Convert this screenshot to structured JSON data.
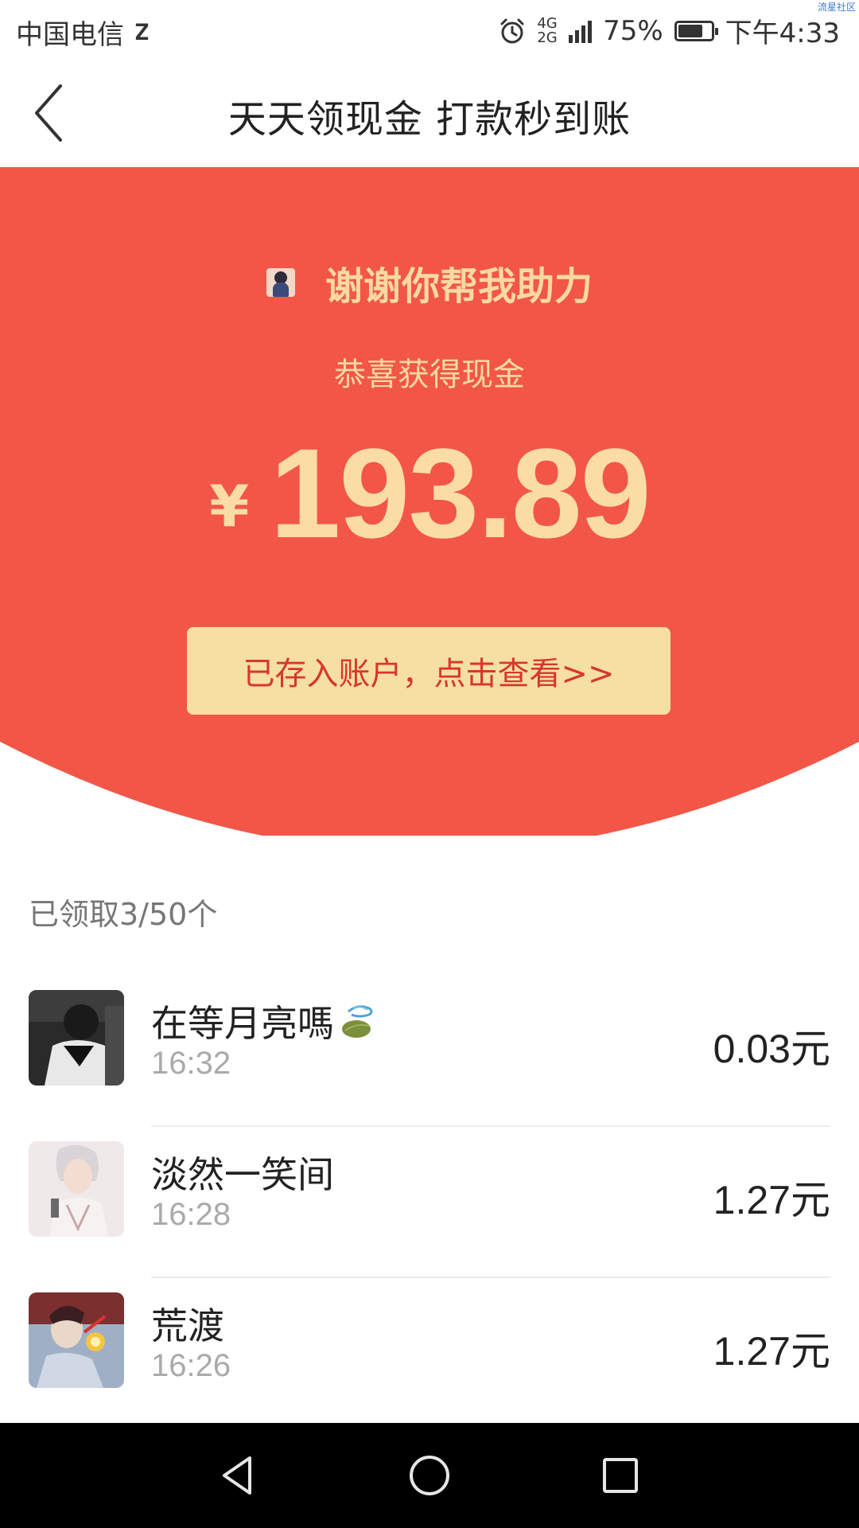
{
  "status_bar": {
    "carrier": "中国电信",
    "carrier_extra": "𝐙",
    "network_badge_top": "4G",
    "network_badge_bottom": "2G",
    "battery_percent": "75%",
    "battery_level": 0.75,
    "time": "下午4:33",
    "watermark": "流星社区"
  },
  "nav": {
    "title": "天天领现金 打款秒到账"
  },
  "hero": {
    "helper_text": "谢谢你帮我助力",
    "congrats_text": "恭喜获得现金",
    "currency_symbol": "¥",
    "amount": "193.89",
    "view_button_label": "已存入账户，点击查看>>",
    "background_color": "#f25647",
    "accent_color": "#fcdca5",
    "button_color": "#f5dfa2"
  },
  "claimed": {
    "label": "已领取3/50个"
  },
  "helpers": [
    {
      "name": "在等月亮嗎",
      "time": "16:32",
      "amount": "0.03元",
      "avatar": "avatar-1",
      "has_tea_emoji": true
    },
    {
      "name": "淡然一笑间",
      "time": "16:28",
      "amount": "1.27元",
      "avatar": "avatar-2",
      "has_tea_emoji": false
    },
    {
      "name": "荒渡",
      "time": "16:26",
      "amount": "1.27元",
      "avatar": "avatar-3",
      "has_tea_emoji": false
    }
  ],
  "icons": {
    "back": "chevron-left-icon",
    "alarm": "alarm-icon",
    "signal": "signal-icon",
    "battery": "battery-icon",
    "tea": "tea-icon",
    "nav_back": "triangle-back-icon",
    "nav_home": "circle-home-icon",
    "nav_recents": "square-recents-icon"
  }
}
